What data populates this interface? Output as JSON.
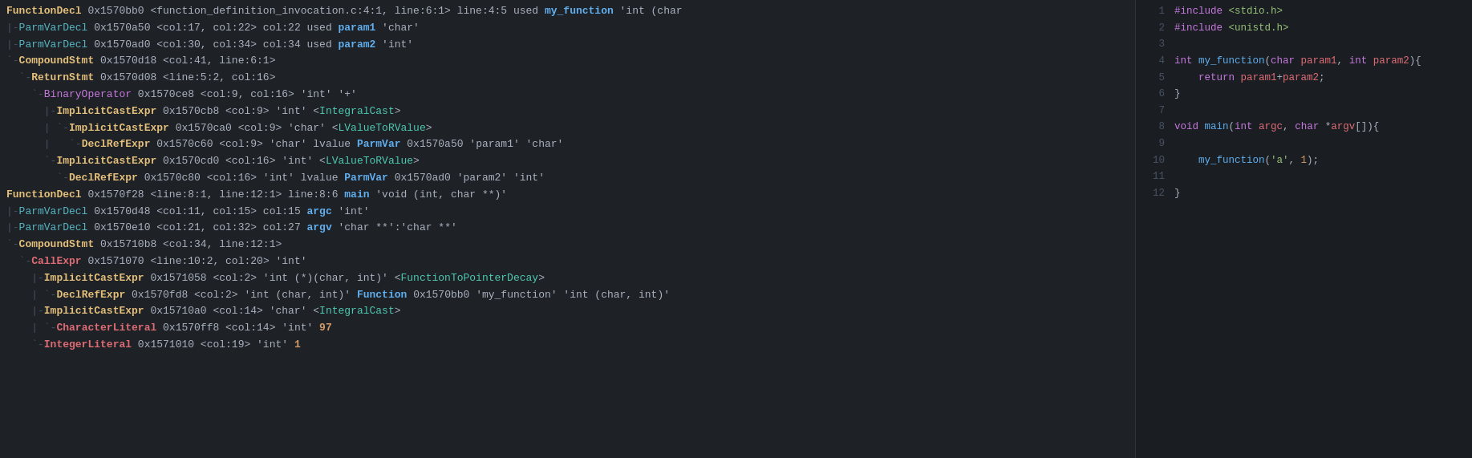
{
  "ast": {
    "lines": [
      {
        "indent": "",
        "prefix_color": "c-yellow",
        "prefix": "FunctionDecl",
        "rest_plain": " 0x1570bb0 <function_definition_invocation.c:4:1, line:6:1> line:4:5 used ",
        "highlight_word": "my_function",
        "highlight_color": "c-blue bold",
        "suffix": " 'int (char"
      },
      {
        "indent": "|-",
        "prefix_color": "c-cyan",
        "prefix": "ParmVarDecl",
        "rest_plain": " 0x1570a50 <col:17, col:22> col:22 used ",
        "highlight_word": "param1",
        "highlight_color": "c-blue bold",
        "suffix": " 'char'"
      },
      {
        "indent": "|-",
        "prefix_color": "c-cyan",
        "prefix": "ParmVarDecl",
        "rest_plain": " 0x1570ad0 <col:30, col:34> col:34 used ",
        "highlight_word": "param2",
        "highlight_color": "c-blue bold",
        "suffix": " 'int'"
      },
      {
        "indent": "`-",
        "prefix_color": "c-yellow",
        "prefix": "CompoundStmt",
        "rest_plain": " 0x1570d18 <col:41, line:6:1>",
        "highlight_word": "",
        "highlight_color": "",
        "suffix": ""
      },
      {
        "indent": "  `-",
        "prefix_color": "c-yellow",
        "prefix": "ReturnStmt",
        "rest_plain": " 0x1570d08 <line:5:2, col:16>",
        "highlight_word": "",
        "highlight_color": "",
        "suffix": ""
      },
      {
        "indent": "    `-",
        "prefix_color": "c-purple",
        "prefix": "BinaryOperator",
        "rest_plain": " 0x1570ce8 <col:9, col:16> 'int' '+'",
        "highlight_word": "",
        "highlight_color": "",
        "suffix": ""
      },
      {
        "indent": "      |-",
        "prefix_color": "c-yellow",
        "prefix": "ImplicitCastExpr",
        "rest_plain": " 0x1570cb8 <col:9> 'int' <",
        "highlight_word": "IntegralCast",
        "highlight_color": "c-teal",
        "suffix": ">"
      },
      {
        "indent": "      | `-",
        "prefix_color": "c-yellow",
        "prefix": "ImplicitCastExpr",
        "rest_plain": " 0x1570ca0 <col:9> 'char' <",
        "highlight_word": "LValueToRValue",
        "highlight_color": "c-teal",
        "suffix": ">"
      },
      {
        "indent": "      |   `-",
        "prefix_color": "c-yellow",
        "prefix": "DeclRefExpr",
        "rest_plain": " 0x1570c60 <col:9> 'char' lvalue ",
        "highlight_word": "ParmVar",
        "highlight_color": "c-blue bold",
        "suffix": " 0x1570a50 'param1' 'char'"
      },
      {
        "indent": "      `-",
        "prefix_color": "c-yellow",
        "prefix": "ImplicitCastExpr",
        "rest_plain": " 0x1570cd0 <col:16> 'int' <",
        "highlight_word": "LValueToRValue",
        "highlight_color": "c-teal",
        "suffix": ">"
      },
      {
        "indent": "        `-",
        "prefix_color": "c-yellow",
        "prefix": "DeclRefExpr",
        "rest_plain": " 0x1570c80 <col:16> 'int' lvalue ",
        "highlight_word": "ParmVar",
        "highlight_color": "c-blue bold",
        "suffix": " 0x1570ad0 'param2' 'int'"
      },
      {
        "indent": "",
        "prefix_color": "c-yellow",
        "prefix": "FunctionDecl",
        "rest_plain": " 0x1570f28 <line:8:1, line:12:1> line:8:6 ",
        "highlight_word": "main",
        "highlight_color": "c-blue bold",
        "suffix": " 'void (int, char **)'"
      },
      {
        "indent": "|-",
        "prefix_color": "c-cyan",
        "prefix": "ParmVarDecl",
        "rest_plain": " 0x1570d48 <col:11, col:15> col:15 ",
        "highlight_word": "argc",
        "highlight_color": "c-blue bold",
        "suffix": " 'int'"
      },
      {
        "indent": "|-",
        "prefix_color": "c-cyan",
        "prefix": "ParmVarDecl",
        "rest_plain": " 0x1570e10 <col:21, col:32> col:27 ",
        "highlight_word": "argv",
        "highlight_color": "c-blue bold",
        "suffix": " 'char **':'char **'"
      },
      {
        "indent": "`-",
        "prefix_color": "c-yellow",
        "prefix": "CompoundStmt",
        "rest_plain": " 0x15710b8 <col:34, line:12:1>",
        "highlight_word": "",
        "highlight_color": "",
        "suffix": ""
      },
      {
        "indent": "  `-",
        "prefix_color": "c-red",
        "prefix": "CallExpr",
        "rest_plain": " 0x1571070 <line:10:2, col:20> 'int'",
        "highlight_word": "",
        "highlight_color": "",
        "suffix": ""
      },
      {
        "indent": "    |-",
        "prefix_color": "c-yellow",
        "prefix": "ImplicitCastExpr",
        "rest_plain": " 0x1571058 <col:2> 'int (*)(char, int)' <",
        "highlight_word": "FunctionToPointerDecay",
        "highlight_color": "c-teal",
        "suffix": ">"
      },
      {
        "indent": "    | `-",
        "prefix_color": "c-yellow",
        "prefix": "DeclRefExpr",
        "rest_plain": " 0x1570fd8 <col:2> 'int (char, int)' ",
        "highlight_word": "Function",
        "highlight_color": "c-blue bold",
        "suffix": " 0x1570bb0 'my_function' 'int (char, int)'"
      },
      {
        "indent": "    |-",
        "prefix_color": "c-yellow",
        "prefix": "ImplicitCastExpr",
        "rest_plain": " 0x15710a0 <col:14> 'char' <",
        "highlight_word": "IntegralCast",
        "highlight_color": "c-teal",
        "suffix": ">"
      },
      {
        "indent": "    | `-",
        "prefix_color": "c-red",
        "prefix": "CharacterLiteral",
        "rest_plain": " 0x1570ff8 <col:14> 'int' ",
        "highlight_word": "97",
        "highlight_color": "c-orange bold",
        "suffix": ""
      },
      {
        "indent": "    `-",
        "prefix_color": "c-red",
        "prefix": "IntegerLiteral",
        "rest_plain": " 0x1571010 <col:19> 'int' ",
        "highlight_word": "1",
        "highlight_color": "c-orange bold",
        "suffix": ""
      }
    ]
  },
  "code": {
    "lines": [
      {
        "num": "1",
        "content": "#include <stdio.h>"
      },
      {
        "num": "2",
        "content": "#include <unistd.h>"
      },
      {
        "num": "3",
        "content": ""
      },
      {
        "num": "4",
        "content": "int my_function(char param1, int param2){"
      },
      {
        "num": "5",
        "content": "    return param1+param2;"
      },
      {
        "num": "6",
        "content": "}"
      },
      {
        "num": "7",
        "content": ""
      },
      {
        "num": "8",
        "content": "void main(int argc, char *argv[]){"
      },
      {
        "num": "9",
        "content": ""
      },
      {
        "num": "10",
        "content": "    my_function('a', 1);"
      },
      {
        "num": "11",
        "content": ""
      },
      {
        "num": "12",
        "content": "}"
      }
    ]
  }
}
